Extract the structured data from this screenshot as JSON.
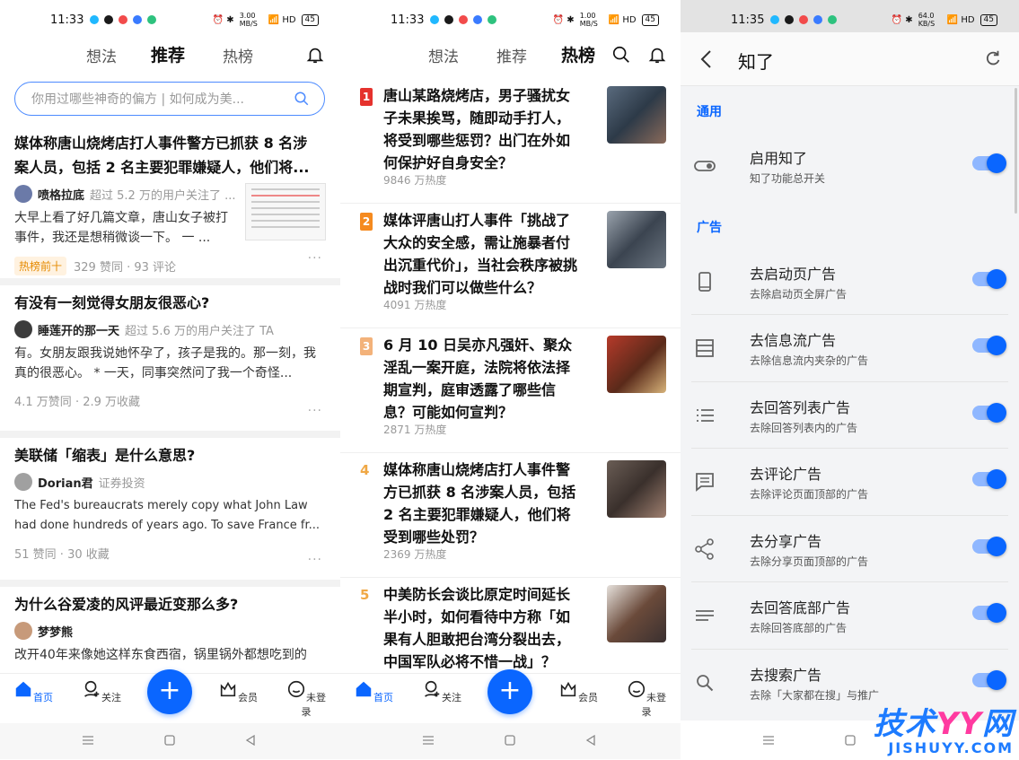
{
  "p1": {
    "status": {
      "time": "11:33",
      "speed": "3.00 MB/S",
      "battery": "45"
    },
    "tabs": [
      "想法",
      "推荐",
      "热榜"
    ],
    "active_tab": "推荐",
    "search_placeholder": "你用过哪些神奇的偏方 | 如何成为美...",
    "cards": [
      {
        "question": "媒体称唐山烧烤店打人事件警方已抓获 8 名涉案人员，包括 2 名主要犯罪嫌疑人，他们将...",
        "author": "喷格拉底",
        "author_desc": "超过 5.2 万的用户关注了 ...",
        "excerpt": "大早上看了好几篇文章，唐山女子被打事件，我还是想稍微谈一下。 一 ...",
        "badge": "热榜前十",
        "meta": "329 赞同 · 93 评论"
      },
      {
        "question": "有没有一刻觉得女朋友很恶心?",
        "author": "睡莲开的那一天",
        "author_desc": "超过 5.6 万的用户关注了 TA",
        "excerpt": "有。女朋友跟我说她怀孕了，孩子是我的。那一刻，我真的很恶心。 * 一天，同事突然问了我一个奇怪...",
        "meta": "4.1 万赞同 · 2.9 万收藏"
      },
      {
        "question": "美联储「缩表」是什么意思?",
        "author": "Dorian君",
        "author_desc": "证券投资",
        "excerpt": "The Fed's bureaucrats merely copy what John Law had done hundreds of years ago. To save France fr...",
        "meta": "51 赞同 · 30 收藏"
      },
      {
        "question": "为什么谷爱凌的风评最近变那么多?",
        "author": "梦梦熊",
        "author_desc": "",
        "excerpt": "改开40年来像她这样东食西宿，锅里锅外都想吃到的",
        "meta": ""
      }
    ]
  },
  "p2": {
    "status": {
      "time": "11:33",
      "speed": "1.00 MB/S",
      "battery": "45"
    },
    "tabs": [
      "想法",
      "推荐",
      "热榜"
    ],
    "active_tab": "热榜",
    "items": [
      {
        "rank": "1",
        "title": "唐山某路烧烤店，男子骚扰女子未果挨骂，随即动手打人，将受到哪些惩罚？出门在外如何保护好自身安全？",
        "heat": "9846 万热度"
      },
      {
        "rank": "2",
        "title": "媒体评唐山打人事件「挑战了大众的安全感，需让施暴者付出沉重代价」，当社会秩序被挑战时我们可以做些什么？",
        "heat": "4091 万热度"
      },
      {
        "rank": "3",
        "title": "6 月 10 日吴亦凡强奸、聚众淫乱一案开庭，法院将依法择期宣判，庭审透露了哪些信息？可能如何宣判？",
        "heat": "2871 万热度"
      },
      {
        "rank": "4",
        "title": "媒体称唐山烧烤店打人事件警方已抓获 8 名涉案人员，包括 2 名主要犯罪嫌疑人，他们将受到哪些处罚？",
        "heat": "2369 万热度"
      },
      {
        "rank": "5",
        "title": "中美防长会谈比原定时间延长半小时，如何看待中方称「如果有人胆敢把台湾分裂出去，中国军队必将不惜一战」？",
        "heat": ""
      }
    ]
  },
  "p3": {
    "status": {
      "time": "11:35",
      "speed": "64.0 KB/S",
      "battery": "45"
    },
    "title": "知了",
    "sections": [
      {
        "label": "通用",
        "rows": [
          {
            "t1": "启用知了",
            "t2": "知了功能总开关",
            "icon": "toggle-icon",
            "on": true
          }
        ]
      },
      {
        "label": "广告",
        "rows": [
          {
            "t1": "去启动页广告",
            "t2": "去除启动页全屏广告",
            "icon": "phone-icon",
            "on": true
          },
          {
            "t1": "去信息流广告",
            "t2": "去除信息流内夹杂的广告",
            "icon": "feed-icon",
            "on": true
          },
          {
            "t1": "去回答列表广告",
            "t2": "去除回答列表内的广告",
            "icon": "list-icon",
            "on": true
          },
          {
            "t1": "去评论广告",
            "t2": "去除评论页面顶部的广告",
            "icon": "comment-icon",
            "on": true
          },
          {
            "t1": "去分享广告",
            "t2": "去除分享页面顶部的广告",
            "icon": "share-icon",
            "on": true
          },
          {
            "t1": "去回答底部广告",
            "t2": "去除回答底部的广告",
            "icon": "lines-icon",
            "on": true
          },
          {
            "t1": "去搜索广告",
            "t2": "去除「大家都在搜」与推广",
            "icon": "search-icon",
            "on": true
          }
        ]
      }
    ]
  },
  "bottom_nav": [
    "首页",
    "关注",
    "会员",
    "未登录"
  ],
  "watermark": {
    "line1a": "技术",
    "line1b": "YY",
    "line1c": "网",
    "line2": "JISHUYY.COM"
  },
  "colors": {
    "accent": "#0a66ff",
    "rank1": "#e5322d",
    "rank2": "#f58a1f",
    "rank3": "#f3b27a",
    "rank4": "#f0a845",
    "rank5": "#f0a845"
  }
}
